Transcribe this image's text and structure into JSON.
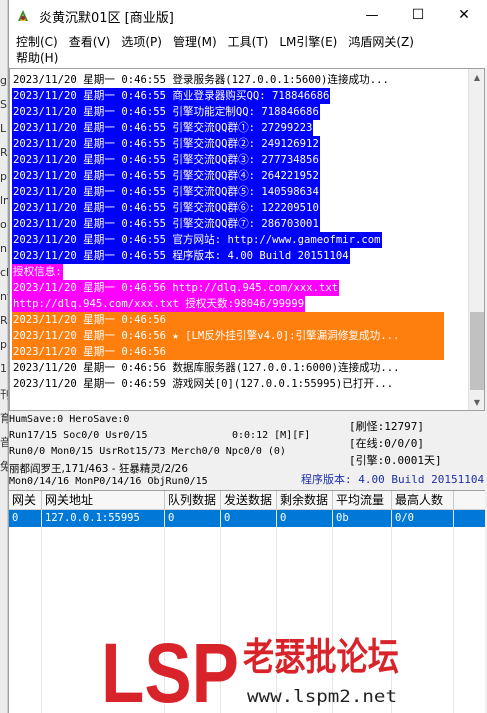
{
  "window": {
    "title": "炎黄沉默01区 [商业版]",
    "controls": {
      "minimize": "—",
      "maximize": "☐",
      "close": "✕"
    }
  },
  "menu": {
    "row1": [
      "控制(C)",
      "查看(V)",
      "选项(P)",
      "管理(M)",
      "工具(T)",
      "LM引擎(E)",
      "鸿盾网关(Z)"
    ],
    "row2": [
      "帮助(H)"
    ]
  },
  "log": {
    "lines": [
      {
        "text": "2023/11/20 星期一 0:46:55 登录服务器(127.0.0.1:5600)连接成功...",
        "style": "plain"
      },
      {
        "text": "2023/11/20 星期一 0:46:55 商业登录器购买QQ: 718846686",
        "style": "blue"
      },
      {
        "text": "2023/11/20 星期一 0:46:55 引擎功能定制QQ: 718846686",
        "style": "blue"
      },
      {
        "text": "2023/11/20 星期一 0:46:55 引擎交流QQ群①: 27299223",
        "style": "blue"
      },
      {
        "text": "2023/11/20 星期一 0:46:55 引擎交流QQ群②: 249126912",
        "style": "blue"
      },
      {
        "text": "2023/11/20 星期一 0:46:55 引擎交流QQ群③: 277734856",
        "style": "blue"
      },
      {
        "text": "2023/11/20 星期一 0:46:55 引擎交流QQ群④: 264221952",
        "style": "blue"
      },
      {
        "text": "2023/11/20 星期一 0:46:55 引擎交流QQ群⑤: 140598634",
        "style": "blue"
      },
      {
        "text": "2023/11/20 星期一 0:46:55 引擎交流QQ群⑥: 122209510",
        "style": "blue"
      },
      {
        "text": "2023/11/20 星期一 0:46:55 引擎交流QQ群⑦: 286703001",
        "style": "blue"
      },
      {
        "text": "2023/11/20 星期一 0:46:55 官方网站: http://www.gameofmir.com",
        "style": "blue"
      },
      {
        "text": "2023/11/20 星期一 0:46:55 程序版本: 4.00 Build 20151104",
        "style": "blue"
      },
      {
        "text": "授权信息:",
        "style": "magenta"
      },
      {
        "text": "2023/11/20 星期一 0:46:56 http://dlq.945.com/xxx.txt",
        "style": "magenta"
      },
      {
        "text": "http://dlq.945.com/xxx.txt 授权天数:98046/99999",
        "style": "magenta"
      },
      {
        "text": "2023/11/20 星期一 0:46:56",
        "style": "orange"
      },
      {
        "text": "2023/11/20 星期一 0:46:56 ★ [LM反外挂引擎v4.0]:引擎漏洞修复成功...",
        "style": "orange"
      },
      {
        "text": "2023/11/20 星期一 0:46:56",
        "style": "orange"
      },
      {
        "text": "2023/11/20 星期一 0:46:56 数据库服务器(127.0.0.1:6000)连接成功...",
        "style": "plain"
      },
      {
        "text": "2023/11/20 星期一 0:46:59 游戏网关[0](127.0.0.1:55995)已打开...",
        "style": "plain"
      }
    ]
  },
  "status": {
    "line1": "HumSave:0 HeroSave:0",
    "line2": "Run17/15 Soc0/0 Usr0/15",
    "timer": "0:0:12 [M][F]",
    "line3": "Run0/0 Mon0/15 UsrRot15/73 Merch0/0 Npc0/0 (0)",
    "line4": "丽都阎罗王,171/463 - 狂暴精灵/2/26",
    "line5": "Mon0/14/16 MonP0/14/16 ObjRun0/15",
    "refresh": "[刷怪:12797]",
    "online": "[在线:0/0/0]",
    "engine": "[引擎:0.0001天]",
    "version": "程序版本: 4.00 Build 20151104"
  },
  "table": {
    "headers": [
      "网关",
      "网关地址",
      "队列数据",
      "发送数据",
      "剩余数据",
      "平均流量",
      "最高人数"
    ],
    "rows": [
      [
        "0",
        "127.0.0.1:55995",
        "0",
        "0",
        "0",
        "0b",
        "0/0"
      ]
    ]
  },
  "watermark": {
    "brand": "LSP",
    "name": "老瑟批论坛",
    "url": "www.lspm2.net"
  },
  "colors": {
    "log_blue": "#0000ff",
    "log_magenta": "#ff00ff",
    "log_orange": "#ff7f0e",
    "selection": "#0078d7",
    "watermark_red": "#d9232a"
  },
  "background_window": {
    "fragments": [
      "g",
      "S",
      "L",
      "R",
      "p",
      "ln",
      "o",
      "n",
      "ck",
      "nf",
      "R",
      "p",
      "1",
      "刊",
      "育",
      "音",
      "兔"
    ]
  }
}
